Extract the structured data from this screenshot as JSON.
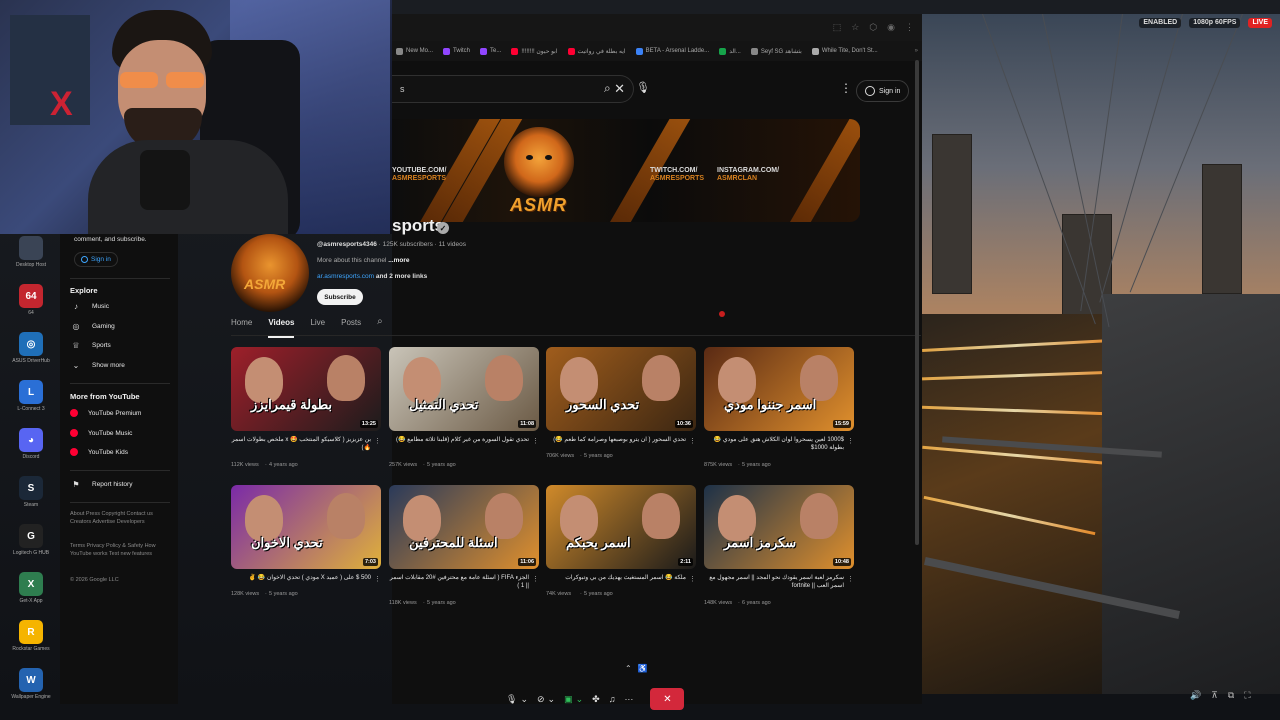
{
  "stream": {
    "badges": [
      "ENABLED",
      "1080p 60FPS",
      "LIVE"
    ]
  },
  "desktop_icons": [
    {
      "label": "Desktop Host",
      "color": "#3a4455",
      "glyph": ""
    },
    {
      "label": "64",
      "color": "#c3262f",
      "glyph": "64"
    },
    {
      "label": "ASUS DriverHub",
      "color": "#1f6fb8",
      "glyph": "◎"
    },
    {
      "label": "L-Connect 3",
      "color": "#2a6fd6",
      "glyph": "L"
    },
    {
      "label": "Discord",
      "color": "#5865f2",
      "glyph": "◕"
    },
    {
      "label": "Steam",
      "color": "#1b2838",
      "glyph": "S"
    },
    {
      "label": "Logitech G HUB",
      "color": "#222222",
      "glyph": "G"
    },
    {
      "label": "Get-X App",
      "color": "#2e7d4f",
      "glyph": "X"
    },
    {
      "label": "Rockstar Games",
      "color": "#f5b400",
      "glyph": "R"
    },
    {
      "label": "Wallpaper Engine",
      "color": "#2463b0",
      "glyph": "W"
    }
  ],
  "bookmarks": [
    {
      "label": "New Mo...",
      "color": "#888888"
    },
    {
      "label": "Twitch",
      "color": "#9146ff"
    },
    {
      "label": "Te...",
      "color": "#9146ff"
    },
    {
      "label": "!!!!!!!! ابو حيون",
      "color": "#ff0033"
    },
    {
      "label": "ايه بطلة في رواتيت",
      "color": "#ff0033"
    },
    {
      "label": "BETA - Arsenal Ladde...",
      "color": "#3b82f6"
    },
    {
      "label": "الد...",
      "color": "#16a34a"
    },
    {
      "label": "Seyf SG بثشاهد",
      "color": "#888888"
    },
    {
      "label": "While Tite, Don't St...",
      "color": "#aaaaaa"
    }
  ],
  "youtube": {
    "search_value": "s",
    "signin_label": "Sign in",
    "banner": {
      "brand": "ASMR",
      "links": [
        {
          "line1": "YOUTUBE.COM/",
          "line2": "ASMRESPORTS"
        },
        {
          "line1": "TWITCH.COM/",
          "line2": "ASMRESPORTS"
        },
        {
          "line1": "INSTAGRAM.COM/",
          "line2": "ASMRCLAN"
        }
      ]
    },
    "channel": {
      "name_fragment": "sports",
      "verified_glyph": "✓",
      "avatar_text": "ASMR",
      "handle": "@asmresports4346",
      "stats": " · 125K subscribers · 11 videos",
      "about": "More about this channel ",
      "about_more": "...more",
      "link": "ar.asmresports.com",
      "link_more": " and 2 more links",
      "subscribe_label": "Subscribe"
    },
    "tabs": [
      "Home",
      "Videos",
      "Live",
      "Posts"
    ],
    "active_tab": "Videos",
    "sidebar": {
      "note": "comment, and subscribe.",
      "signin_label": "Sign in",
      "explore_heading": "Explore",
      "explore_items": [
        {
          "label": "Music",
          "icon": "music-icon",
          "glyph": "♪"
        },
        {
          "label": "Gaming",
          "icon": "gaming-icon",
          "glyph": "◎"
        },
        {
          "label": "Sports",
          "icon": "sports-icon",
          "glyph": "♕"
        },
        {
          "label": "Show more",
          "icon": "chevron-down-icon",
          "glyph": "⌄"
        }
      ],
      "more_heading": "More from YouTube",
      "more_items": [
        {
          "label": "YouTube Premium"
        },
        {
          "label": "YouTube Music"
        },
        {
          "label": "YouTube Kids"
        }
      ],
      "report_label": "Report history",
      "footer1": "About  Press  Copyright  Contact us  Creators  Advertise  Developers",
      "footer2": "Terms  Privacy  Policy & Safety  How YouTube works  Test new features",
      "footer3": "© 2026 Google LLC"
    },
    "videos": [
      {
        "title": "بن عزيزيز ( كلاسيكو المنتخب 🤩 x ملخص بطولات اسمر 🔥)",
        "views": "112K views",
        "age": "4 years ago",
        "duration": "13:25",
        "caption": "بطولة قيمرايزز",
        "bg": "#9e1f2a",
        "accent": "#1c1c1c"
      },
      {
        "title": "تحدي تقول السورة من غير كلام (قلبنا ثلاثة مطامع 😂)",
        "views": "257K views",
        "age": "5 years ago",
        "duration": "11:08",
        "caption": "تحدي التمثيل",
        "bg": "#c9c4b8",
        "accent": "#6b5a45"
      },
      {
        "title": "تحدي السحور ( ان يترو بوصبعها وصرامة كما طعم 😂)",
        "views": "706K views",
        "age": "5 years ago",
        "duration": "10:36",
        "caption": "تحدي السحور",
        "bg": "#a05d1c",
        "accent": "#3b2612"
      },
      {
        "title": "1000$ لعين يسحروا لوان الكلاش هنق على مودي 😂 بطولة 1000$",
        "views": "875K views",
        "age": "5 years ago",
        "duration": "15:59",
        "caption": "اسمر جننوا مودي",
        "bg": "#5a2a14",
        "accent": "#e0902d"
      },
      {
        "title": "500 $ على ( عميد X مودي ) تحدي الاخوان 😂 ✌️",
        "views": "128K views",
        "age": "5 years ago",
        "duration": "7:03",
        "caption": "تحدي الاخوان",
        "bg": "#7a2aa8",
        "accent": "#e0b13a"
      },
      {
        "title": "الجزء FIFA ( اسئلة عامة مع محترفين #20 مقابلات اسمر || 1 )",
        "views": "118K views",
        "age": "5 years ago",
        "duration": "11:06",
        "caption": "اسئلة للمحترفين",
        "bg": "#2a3a5a",
        "accent": "#e0902d"
      },
      {
        "title": "ملكة 😂 اسمر المستغيث يهديك من بي وتبوكرات",
        "views": "74K views",
        "age": "5 years ago",
        "duration": "2:11",
        "caption": "اسمر يحبكم",
        "bg": "#d08a2a",
        "accent": "#1a1a1a"
      },
      {
        "title": "سكرمز لعبة اسمر يقودك نحو المجد || اسمر مجهول مع اسمر العب || fortnite",
        "views": "148K views",
        "age": "6 years ago",
        "duration": "10:48",
        "caption": "سكرمز اسمر",
        "bg": "#1d3148",
        "accent": "#e0902d"
      }
    ]
  },
  "call_toolbar": {
    "hangup_label": "✕"
  }
}
